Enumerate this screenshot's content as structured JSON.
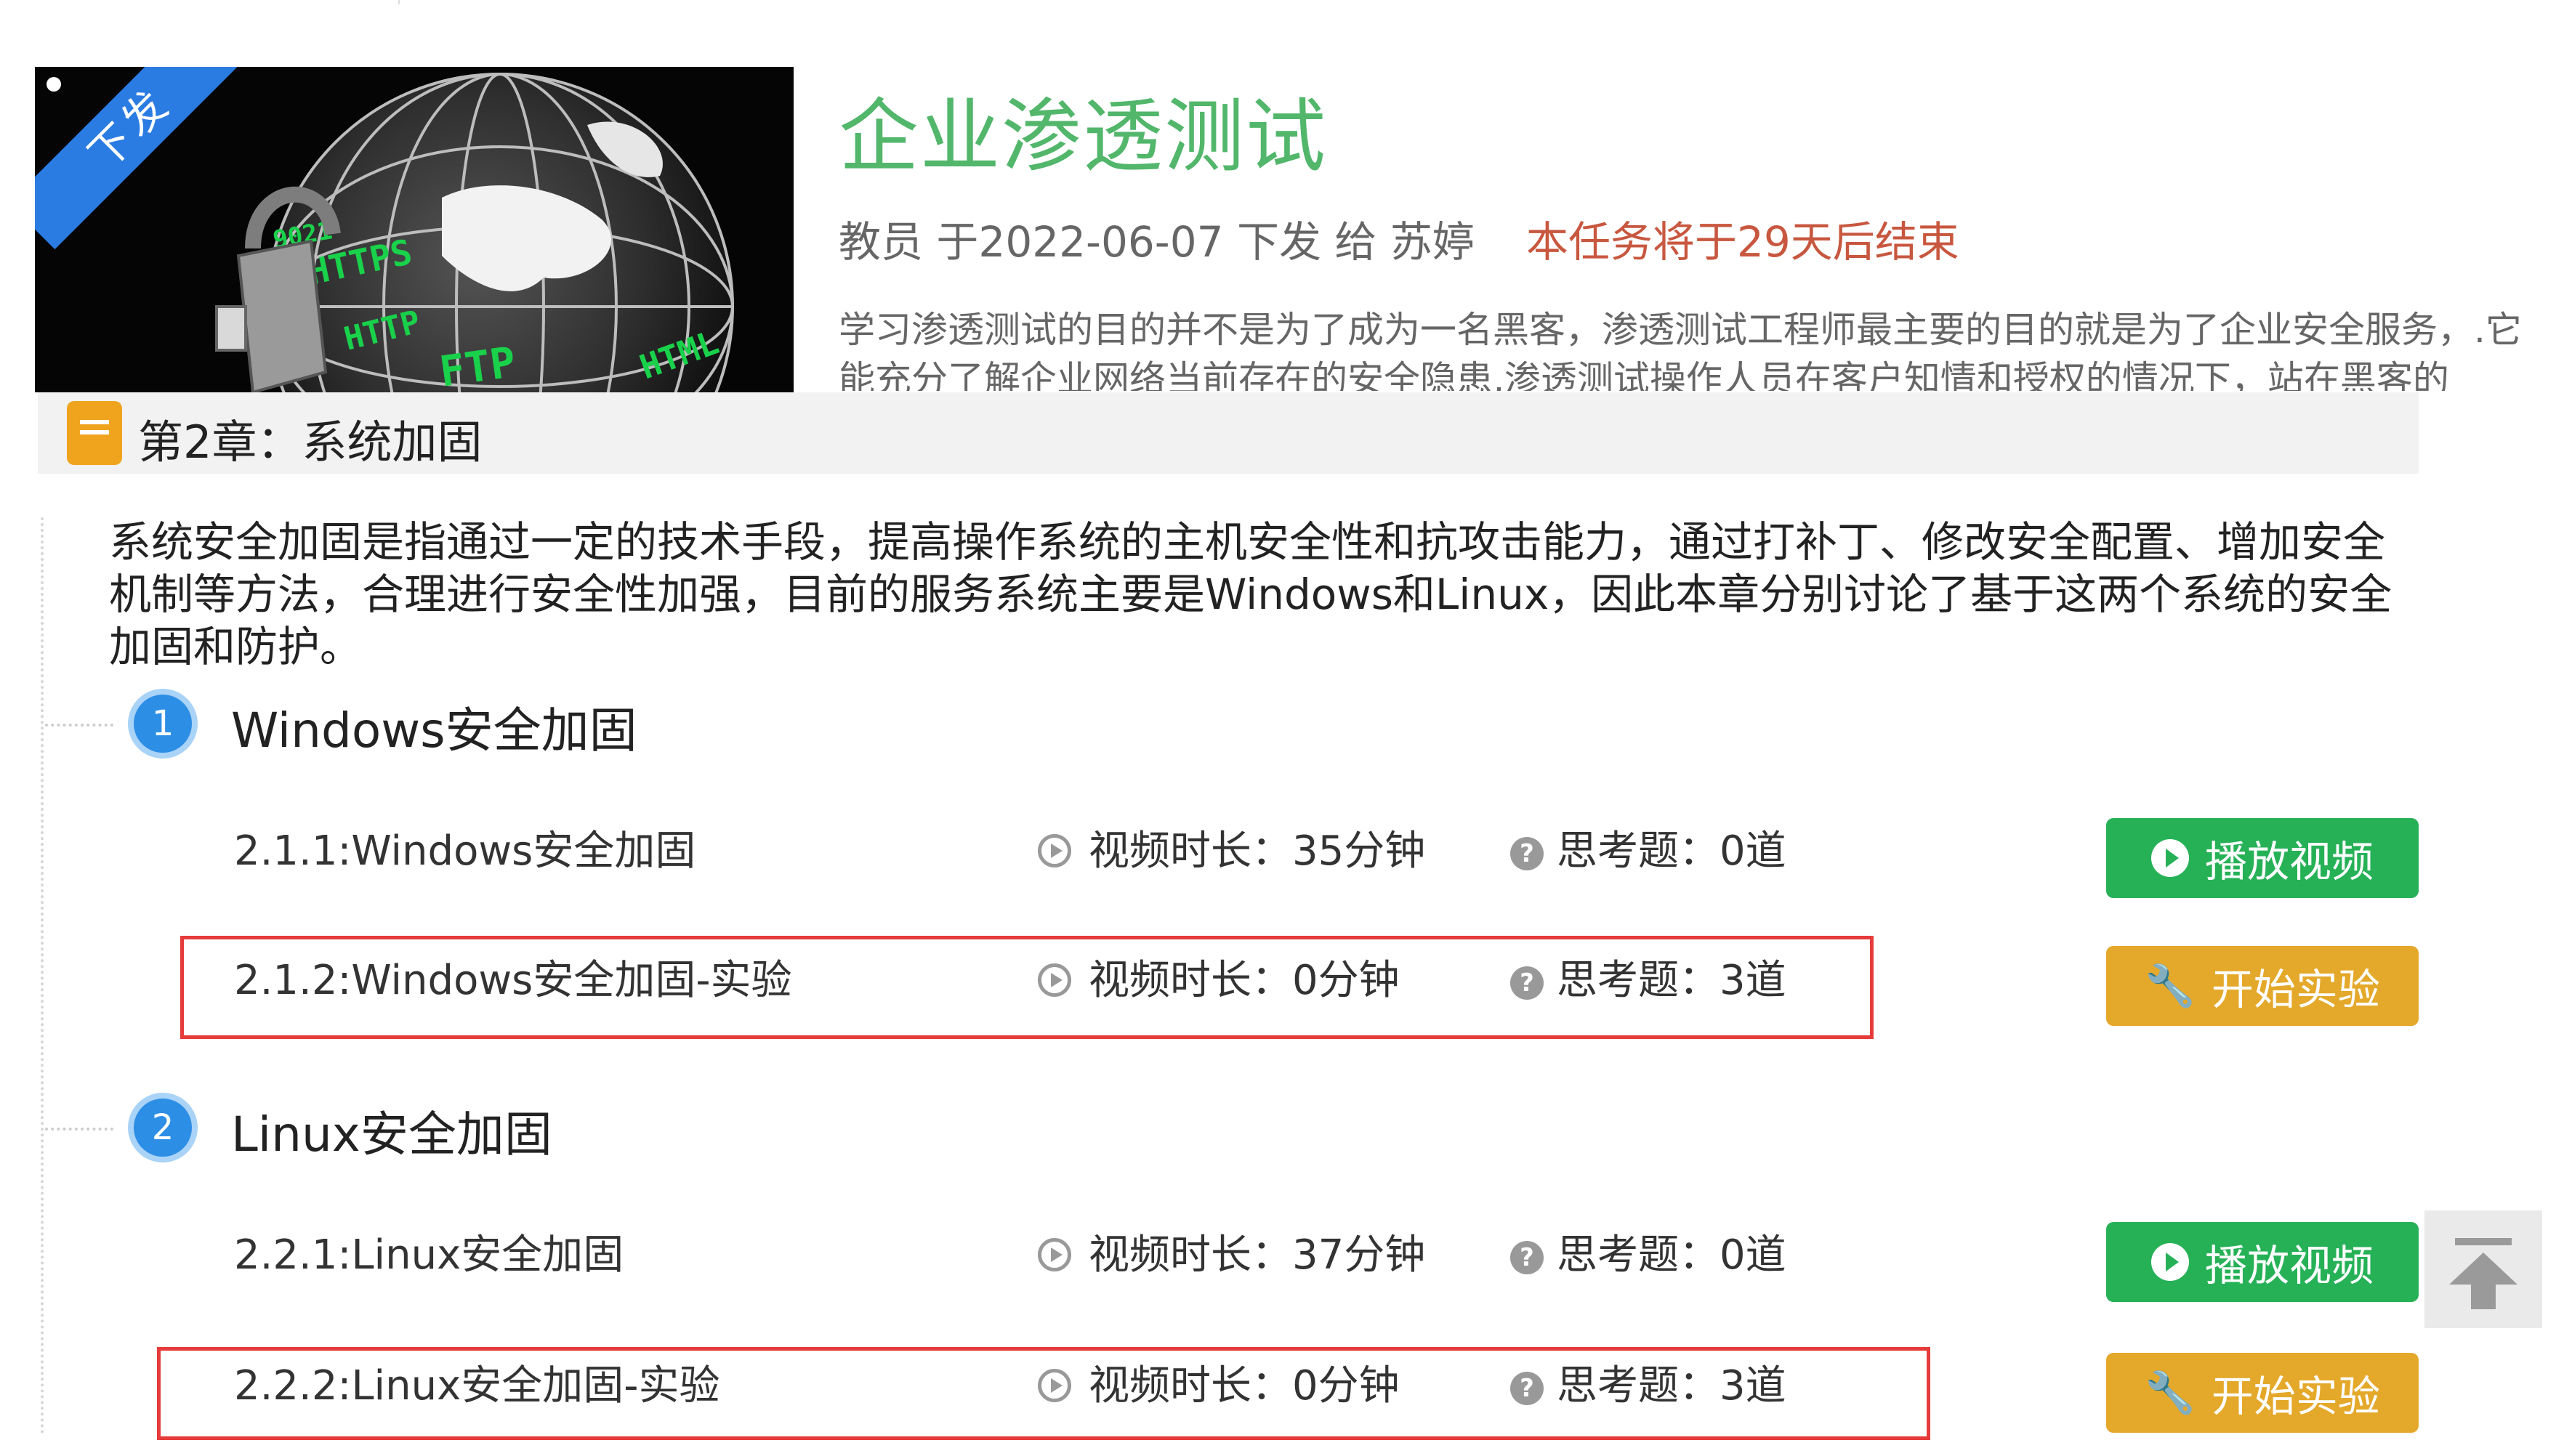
{
  "header": {
    "cover_badge": "下发",
    "title": "企业渗透测试",
    "meta": "教员 于2022-06-07 下发 给 苏婷",
    "deadline": "本任务将于29天后结束",
    "description": "学习渗透测试的目的并不是为了成为一名黑客，渗透测试工程师最主要的目的就是为了企业安全服务，.它能充分了解企业网络当前存在的安全隐患,渗透测试操作人员在客户知情和授权的情况下，站在黑客的"
  },
  "chapter": {
    "title": "第2章：系统加固",
    "intro": "系统安全加固是指通过一定的技术手段，提高操作系统的主机安全性和抗攻击能力，通过打补丁、修改安全配置、增加安全机制等方法，合理进行安全性加强，目前的服务系统主要是Windows和Linux，因此本章分别讨论了基于这两个系统的安全加固和防护。"
  },
  "sections": [
    {
      "num": "1",
      "title": "Windows安全加固",
      "items": [
        {
          "label": "2.1.1:Windows安全加固",
          "duration": "视频时长：35分钟",
          "questions": "思考题：0道",
          "button": "播放视频"
        },
        {
          "label": "2.1.2:Windows安全加固-实验",
          "duration": "视频时长：0分钟",
          "questions": "思考题：3道",
          "button": "开始实验"
        }
      ]
    },
    {
      "num": "2",
      "title": "Linux安全加固",
      "items": [
        {
          "label": "2.2.1:Linux安全加固",
          "duration": "视频时长：37分钟",
          "questions": "思考题：0道",
          "button": "播放视频"
        },
        {
          "label": "2.2.2:Linux安全加固-实验",
          "duration": "视频时长：0分钟",
          "questions": "思考题：3道",
          "button": "开始实验"
        }
      ]
    }
  ],
  "icons": {
    "question_glyph": "?",
    "wrench_glyph": "🔧"
  },
  "colors": {
    "title_green": "#52b66b",
    "deadline_red": "#c8573f",
    "button_green": "#26b157",
    "button_orange": "#e4a82a",
    "highlight_red": "#e63b3b",
    "section_blue": "#2d8ee6"
  }
}
